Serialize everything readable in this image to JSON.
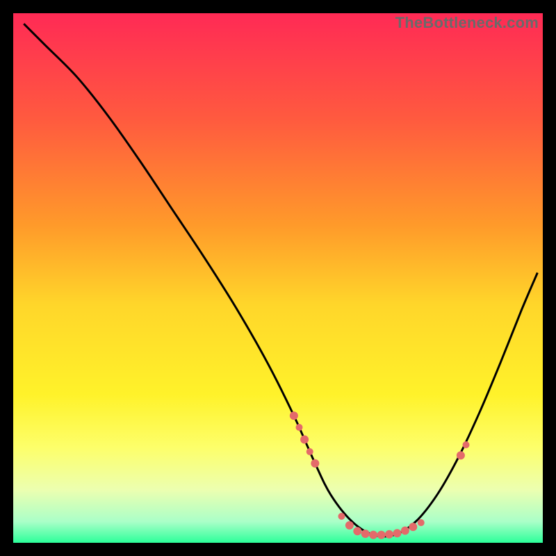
{
  "watermark": "TheBottleneck.com",
  "chart_data": {
    "type": "line",
    "title": "",
    "xlabel": "",
    "ylabel": "",
    "xlim": [
      0,
      100
    ],
    "ylim": [
      0,
      100
    ],
    "grid": false,
    "legend": false,
    "background_gradient": {
      "stops": [
        {
          "offset": 0.0,
          "color": "#ff2a55"
        },
        {
          "offset": 0.2,
          "color": "#ff5a3f"
        },
        {
          "offset": 0.4,
          "color": "#ff9a2a"
        },
        {
          "offset": 0.55,
          "color": "#ffd62a"
        },
        {
          "offset": 0.72,
          "color": "#fff22a"
        },
        {
          "offset": 0.82,
          "color": "#fdff6a"
        },
        {
          "offset": 0.9,
          "color": "#ecffb0"
        },
        {
          "offset": 0.96,
          "color": "#aaffc8"
        },
        {
          "offset": 1.0,
          "color": "#2cff9a"
        }
      ]
    },
    "series": [
      {
        "name": "curve",
        "color": "#000000",
        "x": [
          2,
          6,
          12,
          18,
          24,
          30,
          36,
          42,
          48,
          53,
          57,
          60,
          64,
          68,
          72,
          76,
          80,
          84,
          88,
          92,
          96,
          99
        ],
        "y": [
          98,
          94,
          88,
          80.5,
          72,
          63,
          54,
          44.5,
          34,
          24,
          15,
          9,
          4,
          1.5,
          1.5,
          4,
          9,
          16,
          24.5,
          34,
          44,
          51
        ]
      }
    ],
    "markers": {
      "color": "#e46a6a",
      "points": [
        {
          "x": 53.0,
          "y": 24.0,
          "r": 6
        },
        {
          "x": 54.0,
          "y": 21.8,
          "r": 5
        },
        {
          "x": 55.0,
          "y": 19.5,
          "r": 6
        },
        {
          "x": 56.0,
          "y": 17.2,
          "r": 5
        },
        {
          "x": 57.0,
          "y": 15.0,
          "r": 6
        },
        {
          "x": 62.0,
          "y": 5.0,
          "r": 5
        },
        {
          "x": 63.5,
          "y": 3.3,
          "r": 6
        },
        {
          "x": 65.0,
          "y": 2.2,
          "r": 6
        },
        {
          "x": 66.5,
          "y": 1.7,
          "r": 6
        },
        {
          "x": 68.0,
          "y": 1.5,
          "r": 6
        },
        {
          "x": 69.5,
          "y": 1.5,
          "r": 6
        },
        {
          "x": 71.0,
          "y": 1.6,
          "r": 6
        },
        {
          "x": 72.5,
          "y": 1.8,
          "r": 6
        },
        {
          "x": 74.0,
          "y": 2.3,
          "r": 6
        },
        {
          "x": 75.5,
          "y": 3.0,
          "r": 6
        },
        {
          "x": 77.0,
          "y": 3.8,
          "r": 5
        },
        {
          "x": 84.5,
          "y": 16.5,
          "r": 6
        },
        {
          "x": 85.5,
          "y": 18.5,
          "r": 5
        }
      ]
    }
  }
}
